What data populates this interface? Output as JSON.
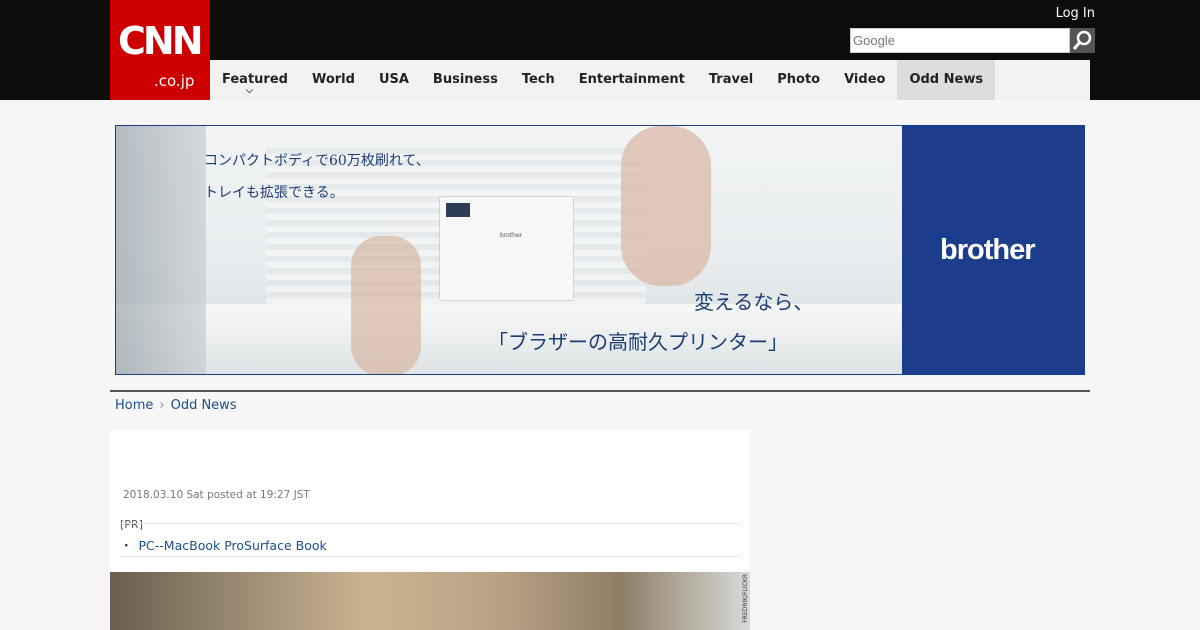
{
  "header": {
    "logo_top": "CNN",
    "logo_bottom": ".co.jp",
    "login": "Log In",
    "search_placeholder": "Google"
  },
  "nav": {
    "items": [
      {
        "label": "Featured"
      },
      {
        "label": "World"
      },
      {
        "label": "USA"
      },
      {
        "label": "Business"
      },
      {
        "label": "Tech"
      },
      {
        "label": "Entertainment"
      },
      {
        "label": "Travel"
      },
      {
        "label": "Photo"
      },
      {
        "label": "Video"
      },
      {
        "label": "Odd News"
      }
    ],
    "active": "Odd News"
  },
  "ad": {
    "copy_line1": "コンパクトボディで60万枚刷れて、",
    "copy_line2": "トレイも拡張できる。",
    "copy_line3": "変えるなら、",
    "copy_line4": "「ブラザーの高耐久プリンター」",
    "brand": "brother",
    "printer_label": "brother",
    "brand_color": "#1b3d8c"
  },
  "breadcrumb": {
    "home": "Home",
    "current": "Odd News"
  },
  "article": {
    "date": "2018.03.10 Sat posted at 19:27 JST",
    "pr_tag": "[PR]",
    "pr_bullet": "・",
    "pr_link": "PC--MacBook ProSurface Book",
    "image_credit": "FREDRIK/FLICKR"
  },
  "colors": {
    "cnn_red": "#cc0000",
    "link_blue": "#1a4f8a",
    "topbar": "#0c0c0c"
  }
}
